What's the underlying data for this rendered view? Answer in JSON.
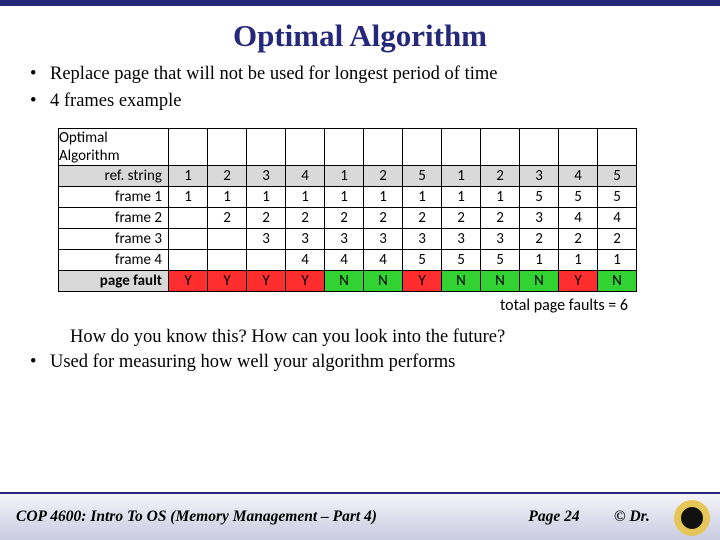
{
  "title": "Optimal Algorithm",
  "bullets_top": [
    "Replace page that will not be used for longest period of time",
    "4 frames example"
  ],
  "table": {
    "heading": "Optimal Algorithm",
    "ref_label": "ref. string",
    "ref": [
      "1",
      "2",
      "3",
      "4",
      "1",
      "2",
      "5",
      "1",
      "2",
      "3",
      "4",
      "5"
    ],
    "frames": [
      {
        "label": "frame 1",
        "cells": [
          "1",
          "1",
          "1",
          "1",
          "1",
          "1",
          "1",
          "1",
          "1",
          "5",
          "5",
          "5"
        ]
      },
      {
        "label": "frame 2",
        "cells": [
          "",
          "2",
          "2",
          "2",
          "2",
          "2",
          "2",
          "2",
          "2",
          "3",
          "4",
          "4"
        ]
      },
      {
        "label": "frame 3",
        "cells": [
          "",
          "",
          "3",
          "3",
          "3",
          "3",
          "3",
          "3",
          "3",
          "2",
          "2",
          "2"
        ]
      },
      {
        "label": "frame 4",
        "cells": [
          "",
          "",
          "",
          "4",
          "4",
          "4",
          "5",
          "5",
          "5",
          "1",
          "1",
          "1"
        ]
      }
    ],
    "fault_label": "page fault",
    "faults": [
      "Y",
      "Y",
      "Y",
      "Y",
      "N",
      "N",
      "Y",
      "N",
      "N",
      "N",
      "Y",
      "N"
    ],
    "totals": "total page faults = 6"
  },
  "question": "How do you know this?  How can you look into the future?",
  "bullets_bottom": [
    "Used for measuring how well your algorithm performs"
  ],
  "footer": {
    "course": "COP 4600: Intro To OS  (Memory Management – Part 4)",
    "page": "Page 24",
    "copy": "© Dr."
  },
  "chart_data": {
    "type": "table",
    "title": "Optimal Algorithm page-replacement trace (4 frames)",
    "reference_string": [
      1,
      2,
      3,
      4,
      1,
      2,
      5,
      1,
      2,
      3,
      4,
      5
    ],
    "frames_over_time": {
      "frame 1": [
        1,
        1,
        1,
        1,
        1,
        1,
        1,
        1,
        1,
        5,
        5,
        5
      ],
      "frame 2": [
        null,
        2,
        2,
        2,
        2,
        2,
        2,
        2,
        2,
        3,
        4,
        4
      ],
      "frame 3": [
        null,
        null,
        3,
        3,
        3,
        3,
        3,
        3,
        3,
        2,
        2,
        2
      ],
      "frame 4": [
        null,
        null,
        null,
        4,
        4,
        4,
        5,
        5,
        5,
        1,
        1,
        1
      ]
    },
    "page_fault": [
      "Y",
      "Y",
      "Y",
      "Y",
      "N",
      "N",
      "Y",
      "N",
      "N",
      "N",
      "Y",
      "N"
    ],
    "total_page_faults": 6
  }
}
